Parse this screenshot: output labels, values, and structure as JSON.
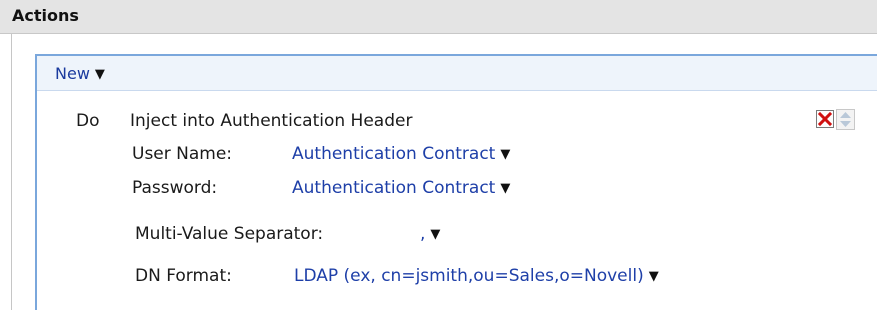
{
  "section": {
    "title": "Actions"
  },
  "panel": {
    "new_label": "New"
  },
  "action": {
    "keyword": "Do",
    "name": "Inject into Authentication Header",
    "user_name_label": "User Name:",
    "user_name_value": "Authentication Contract",
    "password_label": "Password:",
    "password_value": "Authentication Contract",
    "separator_label": "Multi-Value Separator:",
    "separator_value": ",",
    "dn_format_label": "DN Format:",
    "dn_format_value": "LDAP (ex, cn=jsmith,ou=Sales,o=Novell)"
  },
  "icons": {
    "dropdown": "caret-down-icon",
    "delete": "delete-x-icon",
    "reorder": "up-down-arrows-icon"
  },
  "colors": {
    "link": "#1e3fa8",
    "panel_border": "#7aa7dc",
    "delete_x": "#d01010"
  }
}
